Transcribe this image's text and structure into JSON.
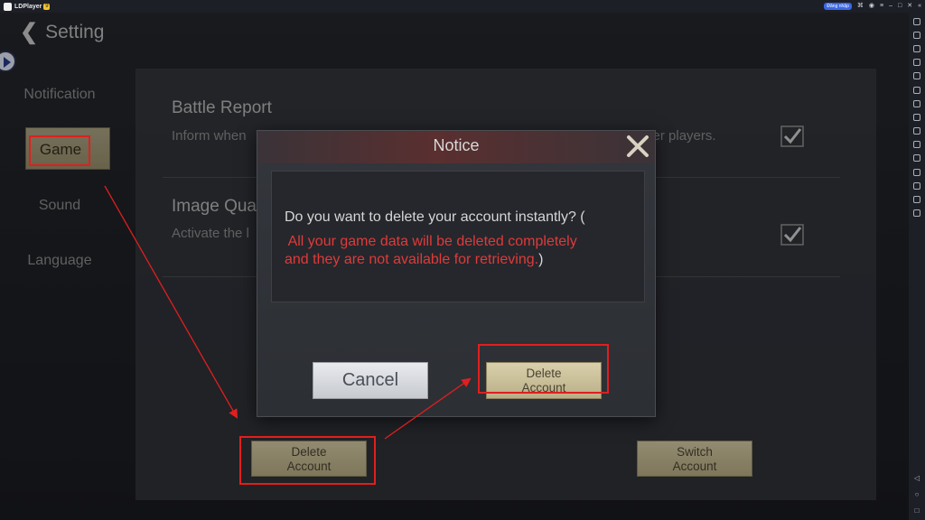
{
  "emulator": {
    "title": "LDPlayer",
    "badge": "9",
    "pill": "Đăng nhập"
  },
  "header": {
    "title": "Setting"
  },
  "nav": {
    "items": [
      {
        "label": "Notification"
      },
      {
        "label": "Game"
      },
      {
        "label": "Sound"
      },
      {
        "label": "Language"
      }
    ],
    "selected": "Game"
  },
  "settings": [
    {
      "title": "Battle Report",
      "description": "Inform when",
      "description_tail": "ther players.",
      "checked": true
    },
    {
      "title": "Image Qua",
      "description": "Activate the l",
      "checked": true
    }
  ],
  "buttons": {
    "delete_account": "Delete\nAccount",
    "switch_account": "Switch\nAccount"
  },
  "modal": {
    "title": "Notice",
    "message": "Do you want to delete your account instantly?  (",
    "warning_lines": [
      " All your game data will be deleted completely",
      "and they are not available for retrieving."
    ],
    "warning_close": ")",
    "cancel_label": "Cancel",
    "confirm_label": "Delete\nAccount"
  },
  "colors": {
    "annotation": "#e01f1f",
    "warning_text": "#e03a3a",
    "gold_button": "#c7bc95"
  }
}
